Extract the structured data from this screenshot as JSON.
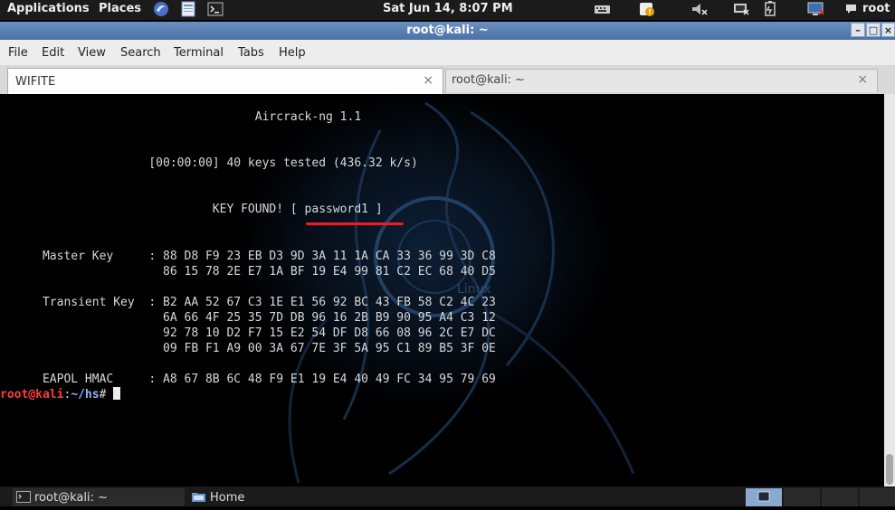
{
  "top_panel": {
    "applications": "Applications",
    "places": "Places",
    "clock": "Sat Jun 14,  8:07 PM",
    "user": "root",
    "icons": [
      "iceweasel-icon",
      "text-editor-icon",
      "terminal-icon",
      "keyboard-icon",
      "notification-icon",
      "volume-muted-icon",
      "network-icon",
      "battery-icon",
      "display-icon",
      "chat-icon"
    ]
  },
  "window": {
    "title": "root@kali: ~",
    "controls": [
      "minimize",
      "maximize",
      "close"
    ]
  },
  "menubar": [
    "File",
    "Edit",
    "View",
    "Search",
    "Terminal",
    "Tabs",
    "Help"
  ],
  "tabs": [
    {
      "label": "WIFITE",
      "active": true
    },
    {
      "label": "root@kali: ~",
      "active": false
    }
  ],
  "terminal": {
    "lines": [
      "                                    Aircrack-ng 1.1",
      "",
      "",
      "                     [00:00:00] 40 keys tested (436.32 k/s)",
      "",
      "",
      "                              KEY FOUND! [ password1 ]",
      "",
      "",
      "      Master Key     : 88 D8 F9 23 EB D3 9D 3A 11 1A CA 33 36 99 3D C8",
      "                       86 15 78 2E E7 1A BF 19 E4 99 81 C2 EC 68 40 D5",
      "",
      "      Transient Key  : B2 AA 52 67 C3 1E E1 56 92 BC 43 FB 58 C2 4C 23",
      "                       6A 66 4F 25 35 7D DB 96 16 2B B9 90 95 A4 C3 12",
      "                       92 78 10 D2 F7 15 E2 54 DF D8 66 08 96 2C E7 DC",
      "                       09 FB F1 A9 00 3A 67 7E 3F 5A 95 C1 89 B5 3F 0E",
      "",
      "      EAPOL HMAC     : A8 67 8B 6C 48 F9 E1 19 E4 40 49 FC 34 95 79 69"
    ],
    "prompt_user": "root@kali",
    "prompt_sep": ":",
    "prompt_path": "~/hs",
    "prompt_symbol": "# ",
    "highlight_color": "#e0202a"
  },
  "taskbar": {
    "items": [
      {
        "label": "root@kali: ~",
        "icon": "terminal-icon"
      },
      {
        "label": "Home",
        "icon": "folder-icon"
      }
    ],
    "workspaces": 4
  }
}
